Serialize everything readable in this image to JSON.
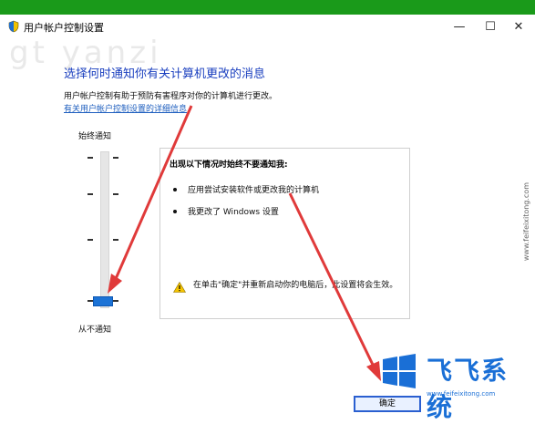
{
  "window": {
    "title": "用户帐户控制设置",
    "minimize": "—",
    "maximize": "☐",
    "close": "✕"
  },
  "watermark": "gt yanzi",
  "content": {
    "heading": "选择何时通知你有关计算机更改的消息",
    "description": "用户帐户控制有助于预防有害程序对你的计算机进行更改。",
    "link": "有关用户帐户控制设置的详细信息",
    "slider": {
      "top_label": "始终通知",
      "bottom_label": "从不通知",
      "level": 0,
      "levels": 4
    },
    "panel": {
      "title": "出现以下情况时始终不要通知我:",
      "bullets": [
        "应用尝试安装软件或更改我的计算机",
        "我更改了 Windows 设置"
      ],
      "warning": "在单击\"确定\"并重新启动你的电脑后，此设置将会生效。"
    }
  },
  "ok_button": "确定",
  "brand": {
    "logo_text": "飞飞系统",
    "url": "www.feifeixitong.com",
    "side_url": "www.feifeixitong.com"
  }
}
